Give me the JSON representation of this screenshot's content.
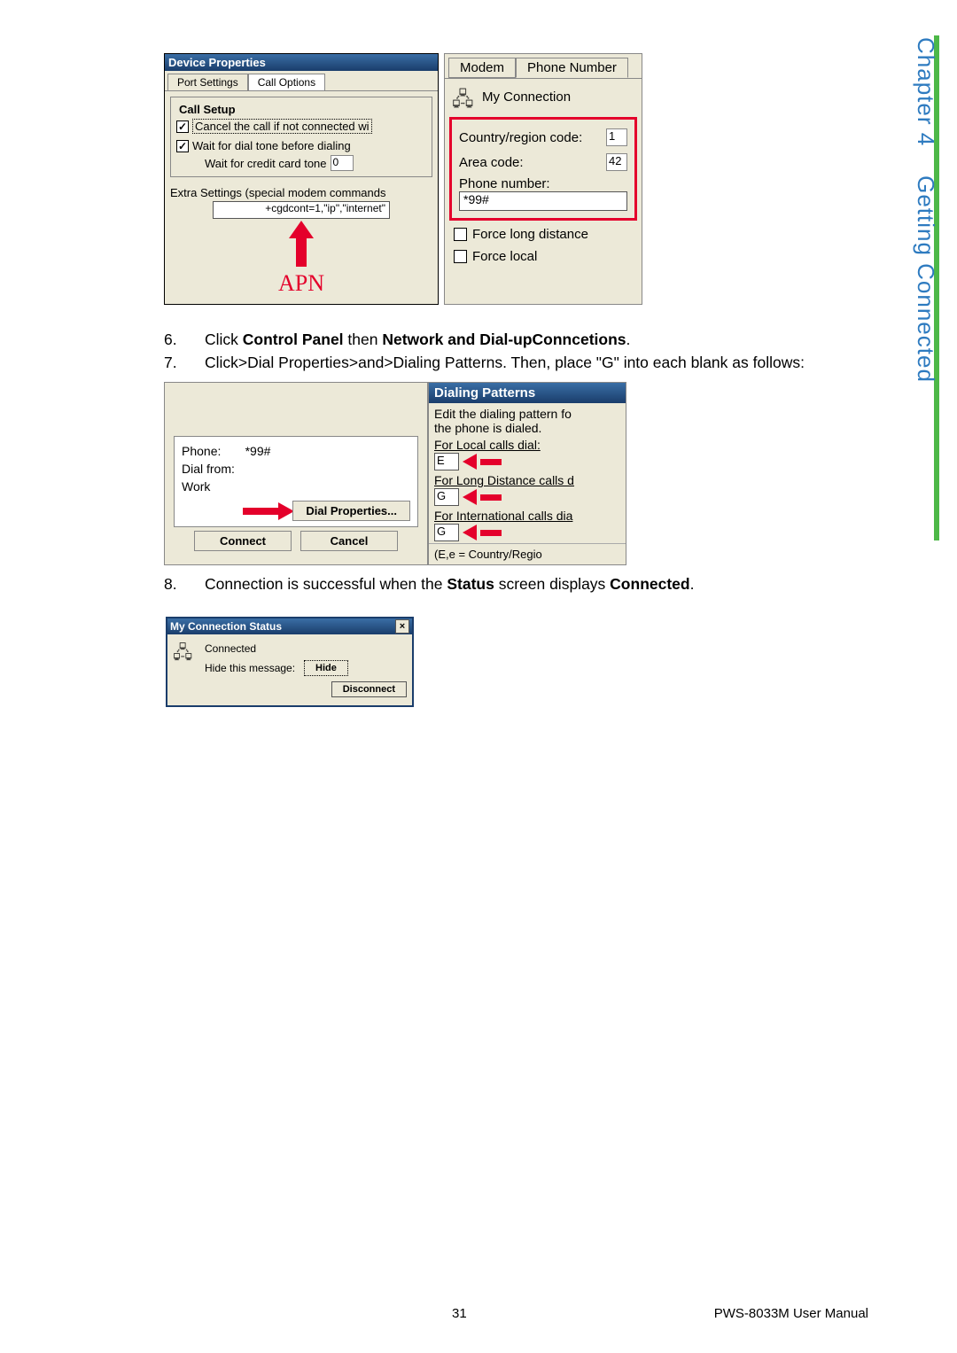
{
  "side": {
    "chapter": "Chapter 4",
    "title": "Getting Connected"
  },
  "devprops": {
    "title": "Device Properties",
    "tab1": "Port Settings",
    "tab2": "Call Options",
    "fieldset": "Call Setup",
    "chk1": "Cancel the call if not connected wi",
    "chk2": "Wait for dial tone before dialing",
    "waitCredit": "Wait for credit card tone",
    "waitCreditVal": "0",
    "extraLabel": "Extra Settings (special modem commands",
    "extraVal": "+cgdcont=1,\"ip\",\"internet\"",
    "apn": "APN"
  },
  "phonenum": {
    "tab1": "Modem",
    "tab2": "Phone Number",
    "connName": "My Connection",
    "countryLabel": "Country/region code:",
    "countryVal": "1",
    "areaLabel": "Area code:",
    "areaVal": "42",
    "phoneLabel": "Phone number:",
    "phoneVal": "*99#",
    "forceLong": "Force long distance",
    "forceLocal": "Force local"
  },
  "instr": {
    "n6": "6.",
    "t6a": "Click ",
    "t6b": "Control Panel",
    "t6c": " then ",
    "t6d": "Network and Dial-upConncetions",
    "t6e": ".",
    "n7": "7.",
    "t7": "Click>Dial Properties>and>Dialing Patterns. Then, place \"G\" into each blank as follows:",
    "n8": "8.",
    "t8a": "Connection is successful when the ",
    "t8b": "Status",
    "t8c": " screen displays ",
    "t8d": "Connected",
    "t8e": "."
  },
  "dialbox": {
    "phone": "Phone:",
    "phoneVal": "*99#",
    "dialFrom": "Dial from:",
    "work": "Work",
    "dialProps": "Dial Properties...",
    "connect": "Connect",
    "cancel": "Cancel"
  },
  "dialpat": {
    "title": "Dialing Patterns",
    "sub1": "Edit the dialing pattern fo",
    "sub2": "the phone is dialed.",
    "local": "For Local calls dial:",
    "localVal": "E",
    "long": "For Long Distance calls d",
    "longVal": "G",
    "intl": "For International calls dia",
    "intlVal": "G",
    "foot": "(E,e = Country/Regio"
  },
  "mcs": {
    "title": "My Connection Status",
    "status": "Connected",
    "hideLabel": "Hide this message:",
    "hide": "Hide",
    "disconnect": "Disconnect"
  },
  "footer": {
    "page": "31",
    "manual": "PWS-8033M User Manual"
  }
}
